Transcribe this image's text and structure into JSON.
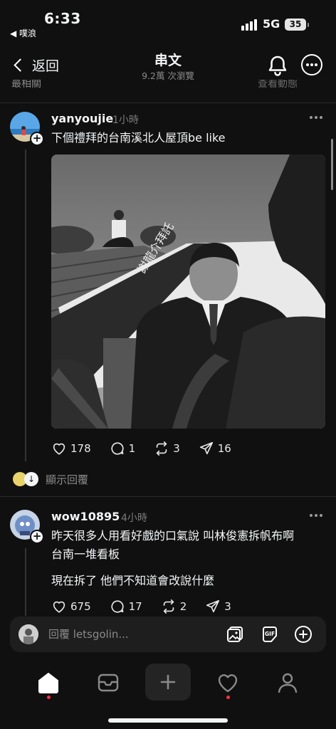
{
  "status_bar": {
    "time": "6:33",
    "back_label": "◀ 噗浪",
    "network": "5G",
    "battery": "35"
  },
  "header": {
    "back_label": "返回",
    "title": "串文",
    "subtitle": "9.2萬 次瀏覽"
  },
  "hidden_strip": {
    "left": "最相關",
    "right": "查看動態"
  },
  "posts": [
    {
      "username": "yanyoujie",
      "time": "1小時",
      "text": "下個禮拜的台南溪北人屋頂be like",
      "image_banner_text": "謝龍介拜託",
      "likes": "178",
      "comments": "1",
      "reposts": "3",
      "shares": "16"
    },
    {
      "username": "wow10895",
      "time": "4小時",
      "text_lines": [
        "昨天很多人用看好戲的口氣說 叫林俊憲拆帆布啊",
        "台南一堆看板",
        "現在拆了 他們不知道會改說什麼"
      ],
      "likes": "675",
      "comments": "17",
      "reposts": "2",
      "shares": "3"
    }
  ],
  "show_replies": {
    "label": "顯示回覆"
  },
  "reply_bar": {
    "placeholder": "回覆 letsgolin..."
  },
  "tabs": [
    "home-icon",
    "inbox-icon",
    "compose-icon",
    "heart-icon",
    "profile-icon"
  ],
  "colors": {
    "background": "#101010",
    "text": "#f3f5f7",
    "muted": "#8a8a8a",
    "notification_dot": "#ff3040"
  }
}
